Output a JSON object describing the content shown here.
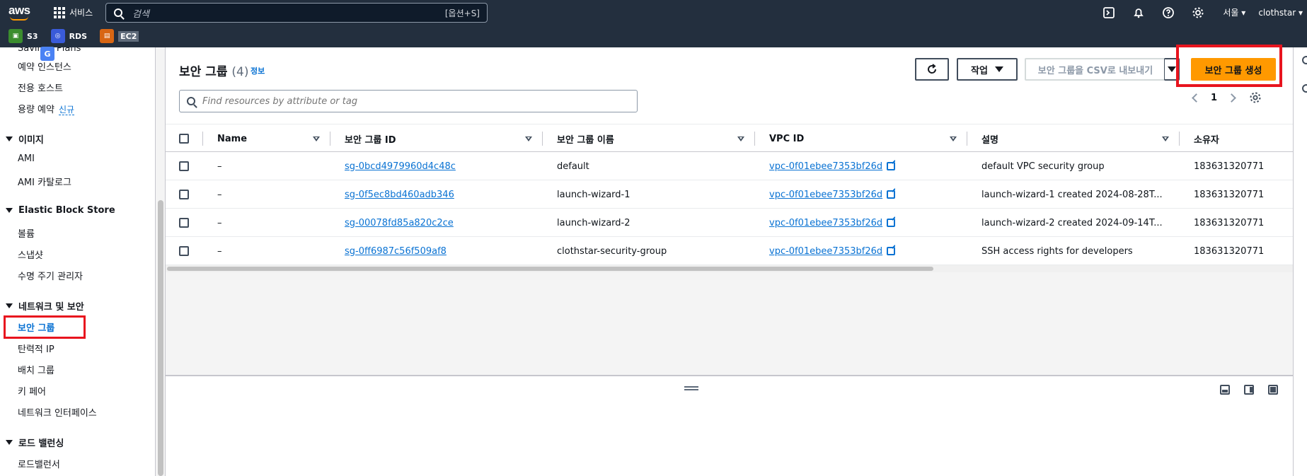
{
  "topnav": {
    "logo": "aws",
    "services": "서비스",
    "search_placeholder": "검색",
    "search_shortcut": "[옵션+S]",
    "region": "서울",
    "user": "clothstar"
  },
  "favorites": [
    {
      "label": "S3",
      "color": "#3b8d2e"
    },
    {
      "label": "RDS",
      "color": "#3a5bd9"
    },
    {
      "label": "EC2",
      "color": "#d86613"
    }
  ],
  "sidebar": {
    "items_top": [
      {
        "label": "Savings Plans"
      },
      {
        "label": "예약 인스턴스"
      },
      {
        "label": "전용 호스트"
      },
      {
        "label": "용량 예약",
        "badge": "신규"
      }
    ],
    "sections": [
      {
        "title": "이미지",
        "items": [
          "AMI",
          "AMI 카탈로그"
        ]
      },
      {
        "title": "Elastic Block Store",
        "items": [
          "볼륨",
          "스냅샷",
          "수명 주기 관리자"
        ]
      },
      {
        "title": "네트워크 및 보안",
        "items": [
          "보안 그룹",
          "탄력적 IP",
          "배치 그룹",
          "키 페어",
          "네트워크 인터페이스"
        ]
      },
      {
        "title": "로드 밸런싱",
        "items": [
          "로드밸런서"
        ]
      }
    ]
  },
  "header": {
    "title": "보안 그룹",
    "count": "(4)",
    "info": "정보",
    "actions_label": "작업",
    "export_label": "보안 그룹을 CSV로 내보내기",
    "create_label": "보안 그룹 생성",
    "filter_placeholder": "Find resources by attribute or tag",
    "page": "1"
  },
  "table": {
    "columns": [
      "Name",
      "보안 그룹 ID",
      "보안 그룹 이름",
      "VPC ID",
      "설명",
      "소유자"
    ],
    "rows": [
      {
        "name": "–",
        "sg_id": "sg-0bcd4979960d4c48c",
        "sg_name": "default",
        "vpc": "vpc-0f01ebee7353bf26d",
        "desc": "default VPC security group",
        "owner": "183631320771"
      },
      {
        "name": "–",
        "sg_id": "sg-0f5ec8bd460adb346",
        "sg_name": "launch-wizard-1",
        "vpc": "vpc-0f01ebee7353bf26d",
        "desc": "launch-wizard-1 created 2024-08-28T...",
        "owner": "183631320771"
      },
      {
        "name": "–",
        "sg_id": "sg-00078fd85a820c2ce",
        "sg_name": "launch-wizard-2",
        "vpc": "vpc-0f01ebee7353bf26d",
        "desc": "launch-wizard-2 created 2024-09-14T...",
        "owner": "183631320771"
      },
      {
        "name": "–",
        "sg_id": "sg-0ff6987c56f509af8",
        "sg_name": "clothstar-security-group",
        "vpc": "vpc-0f01ebee7353bf26d",
        "desc": "SSH access rights for developers",
        "owner": "183631320771"
      }
    ]
  },
  "colors": {
    "nav_bg": "#232f3e",
    "primary": "#ff9900",
    "link": "#0972d3",
    "highlight": "#e8141e"
  }
}
